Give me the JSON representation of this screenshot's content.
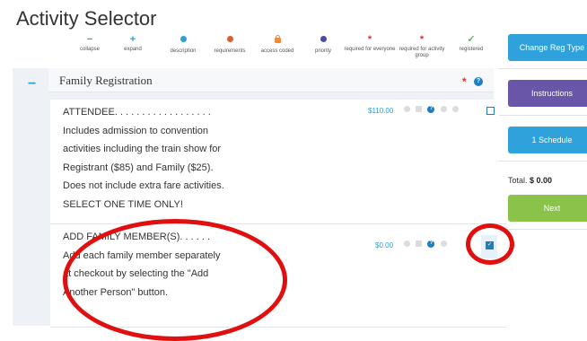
{
  "page": {
    "title": "Activity Selector"
  },
  "legend": [
    {
      "name": "collapse-legend",
      "icon": "minus",
      "label": "collapse",
      "color": "#2a9fd8"
    },
    {
      "name": "expand-legend",
      "icon": "plus",
      "label": "expand",
      "color": "#2a9fd8"
    },
    {
      "name": "description-legend",
      "icon": "question-circle",
      "label": "description",
      "color": "#2a9fd8"
    },
    {
      "name": "requirements-legend",
      "icon": "alert-circle",
      "label": "requirements",
      "color": "#e05a2a"
    },
    {
      "name": "access-coded-legend",
      "icon": "lock",
      "label": "access coded",
      "color": "#f08a3c"
    },
    {
      "name": "priority-legend",
      "icon": "circle",
      "label": "priority",
      "color": "#4a4aa8"
    },
    {
      "name": "required-everyone-legend",
      "icon": "asterisk",
      "label": "required for everyone",
      "color": "#e03030"
    },
    {
      "name": "required-group-legend",
      "icon": "asterisk",
      "label": "required for activity group",
      "color": "#e03030"
    },
    {
      "name": "registered-legend",
      "icon": "check",
      "label": "registered",
      "color": "#5cb85c"
    }
  ],
  "group": {
    "collapse_label": "−",
    "title": "Family Registration",
    "required_mark": "*",
    "description_mark": "?"
  },
  "items": [
    {
      "title": "ATTENDEE. . . . . . . . . . . . . . . . . .",
      "lines": [
        "Includes admission to convention",
        "activities including the train show for",
        "Registrant ($85) and Family ($25).",
        "Does not include extra fare activities.",
        "SELECT ONE TIME ONLY!"
      ],
      "price": "$110.00",
      "checked": false
    },
    {
      "title": "ADD FAMILY MEMBER(S). . . . . .",
      "lines": [
        "Add each family member separately",
        "at checkout by selecting the \"Add",
        "Another Person\" button."
      ],
      "price": "$0.00",
      "checked": true
    }
  ],
  "sidebar": {
    "change_reg_type": "Change Reg Type",
    "instructions": "Instructions",
    "schedule": "1 Schedule",
    "total_label": "Total.",
    "total_value": "$ 0.00",
    "next": "Next"
  },
  "colors": {
    "accent_blue": "#2fa2dc",
    "purple": "#6a56a8",
    "green": "#8bc34a",
    "annotation_red": "#e01010"
  }
}
